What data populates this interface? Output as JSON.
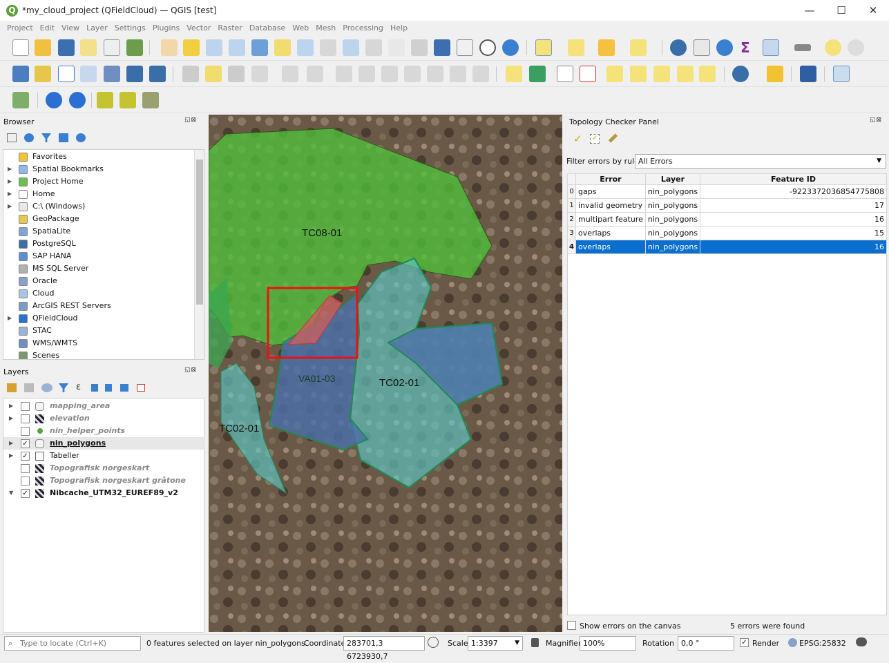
{
  "window": {
    "title": "*my_cloud_project (QFieldCloud) — QGIS [test]",
    "min": "—",
    "max": "☐",
    "close": "✕"
  },
  "menu": [
    "Project",
    "Edit",
    "View",
    "Layer",
    "Settings",
    "Plugins",
    "Vector",
    "Raster",
    "Database",
    "Web",
    "Mesh",
    "Processing",
    "Help"
  ],
  "browser": {
    "title": "Browser",
    "items": [
      {
        "label": "Favorites",
        "arrow": "",
        "color": "#f4c430"
      },
      {
        "label": "Spatial Bookmarks",
        "arrow": "▶",
        "color": "#8fb9e8"
      },
      {
        "label": "Project Home",
        "arrow": "▶",
        "color": "#6bbf4e"
      },
      {
        "label": "Home",
        "arrow": "▶",
        "color": "#ffffff"
      },
      {
        "label": "C:\\ (Windows)",
        "arrow": "▶",
        "color": "#e8e8e8"
      },
      {
        "label": "GeoPackage",
        "arrow": "",
        "color": "#e6c74a"
      },
      {
        "label": "SpatiaLite",
        "arrow": "",
        "color": "#7fa7d6"
      },
      {
        "label": "PostgreSQL",
        "arrow": "",
        "color": "#3b6ea5"
      },
      {
        "label": "SAP HANA",
        "arrow": "",
        "color": "#5b8fd1"
      },
      {
        "label": "MS SQL Server",
        "arrow": "",
        "color": "#b0b0b0"
      },
      {
        "label": "Oracle",
        "arrow": "",
        "color": "#8aa0c8"
      },
      {
        "label": "Cloud",
        "arrow": "",
        "color": "#a8c4e6"
      },
      {
        "label": "ArcGIS REST Servers",
        "arrow": "",
        "color": "#7e9ac6"
      },
      {
        "label": "QFieldCloud",
        "arrow": "▶",
        "color": "#2a6fd1"
      },
      {
        "label": "STAC",
        "arrow": "",
        "color": "#9ab3d6"
      },
      {
        "label": "WMS/WMTS",
        "arrow": "",
        "color": "#6e8fbf"
      },
      {
        "label": "Scenes",
        "arrow": "",
        "color": "#7a9a6a"
      }
    ]
  },
  "layers": {
    "title": "Layers",
    "items": [
      {
        "label": "mapping_area",
        "checked": false,
        "style": "italic-grey",
        "icon": "polygon-icon",
        "arrow": "▶"
      },
      {
        "label": "elevation",
        "checked": false,
        "style": "italic-grey",
        "icon": "raster-icon",
        "arrow": "▶"
      },
      {
        "label": "nin_helper_points",
        "checked": false,
        "style": "italic-grey",
        "icon": "point-icon",
        "arrow": ""
      },
      {
        "label": "nin_polygons",
        "checked": true,
        "style": "bold-underline",
        "icon": "polygon-icon",
        "arrow": "▶"
      },
      {
        "label": "Tabeller",
        "checked": true,
        "style": "normal",
        "icon": "group-icon",
        "arrow": "▶"
      },
      {
        "label": "Topografisk norgeskart",
        "checked": false,
        "style": "italic-grey",
        "icon": "raster-icon",
        "arrow": ""
      },
      {
        "label": "Topografisk norgeskart gråtone",
        "checked": false,
        "style": "italic-grey",
        "icon": "raster-icon",
        "arrow": ""
      },
      {
        "label": "Nibcache_UTM32_EUREF89_v2",
        "checked": true,
        "style": "bold",
        "icon": "raster-icon",
        "arrow": "▼"
      }
    ]
  },
  "map": {
    "labels": {
      "tc08": "TC08-01",
      "va01": "VA01-03",
      "tc02a": "TC02-01",
      "tc02b": "TC02-01"
    }
  },
  "topology": {
    "title": "Topology Checker Panel",
    "filter_label": "Filter errors by rule",
    "filter_value": "All Errors",
    "columns": [
      "Error",
      "Layer",
      "Feature ID"
    ],
    "rows": [
      {
        "idx": "0",
        "error": "gaps",
        "layer": "nin_polygons",
        "fid": "-9223372036854775808"
      },
      {
        "idx": "1",
        "error": "invalid geometry",
        "layer": "nin_polygons",
        "fid": "17"
      },
      {
        "idx": "2",
        "error": "multipart feature",
        "layer": "nin_polygons",
        "fid": "16"
      },
      {
        "idx": "3",
        "error": "overlaps",
        "layer": "nin_polygons",
        "fid": "15"
      },
      {
        "idx": "4",
        "error": "overlaps",
        "layer": "nin_polygons",
        "fid": "16"
      }
    ],
    "selected_row": 4,
    "show_errors_label": "Show errors on the canvas",
    "errors_found": "5 errors were found"
  },
  "status": {
    "locate_placeholder": "Type to locate (Ctrl+K)",
    "message": "0 features selected on layer nin_polygons.",
    "coordinate_label": "Coordinate",
    "coordinate_value": "283701,3  6723930,7",
    "scale_label": "Scale",
    "scale_value": "1:3397",
    "magnifier_label": "Magnifier",
    "magnifier_value": "100%",
    "rotation_label": "Rotation",
    "rotation_value": "0,0 °",
    "render_label": "Render",
    "crs": "EPSG:25832"
  }
}
